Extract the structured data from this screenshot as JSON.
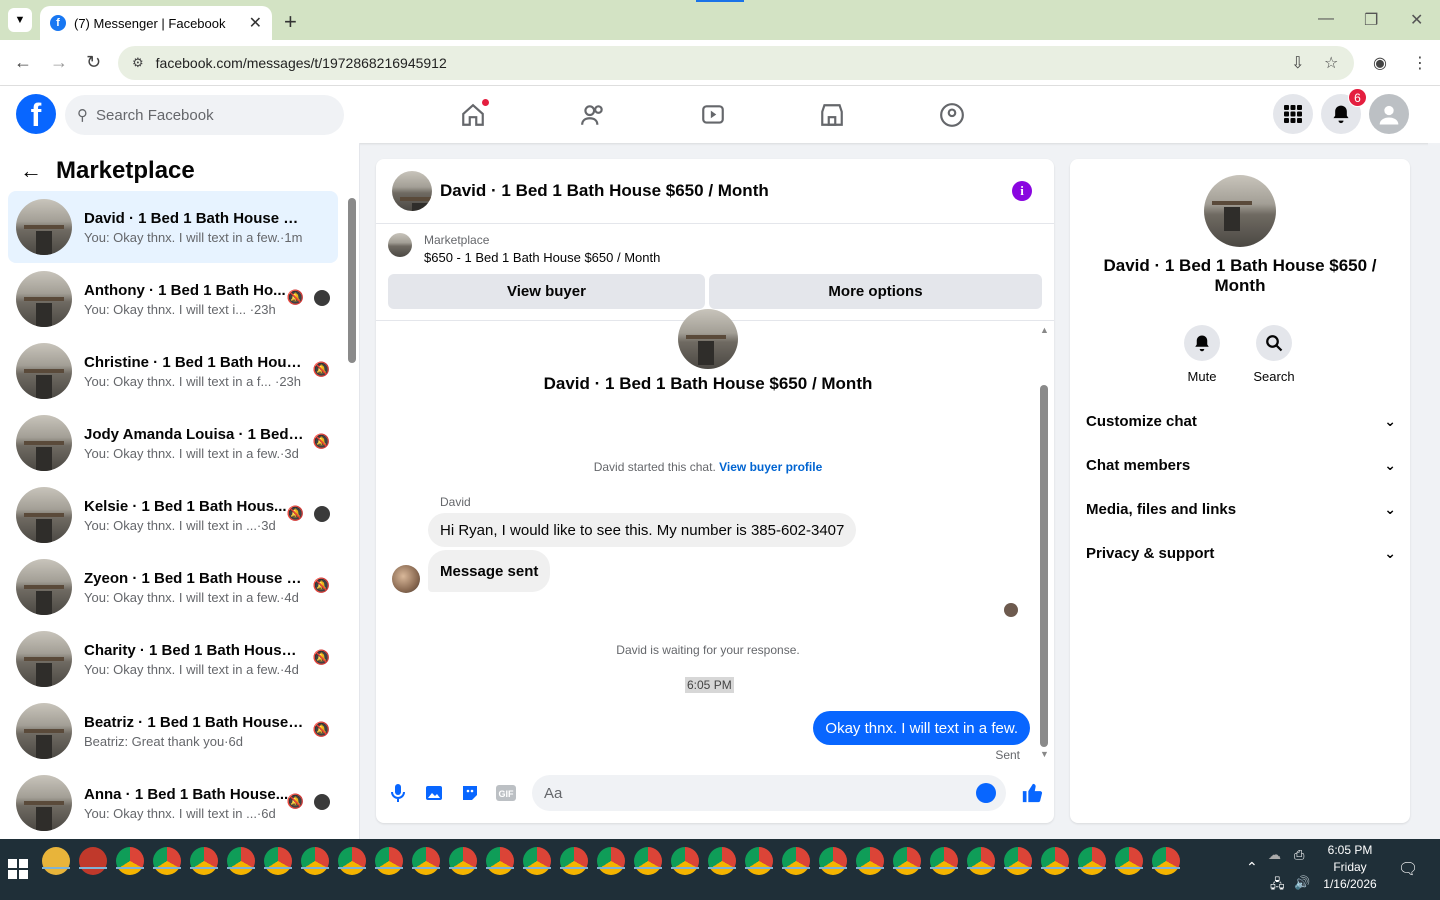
{
  "browser": {
    "tab_title": "(7) Messenger | Facebook",
    "url": "facebook.com/messages/t/1972868216945912"
  },
  "fb": {
    "search_placeholder": "Search Facebook",
    "notif_count": "6"
  },
  "sidebar": {
    "title": "Marketplace",
    "items": [
      {
        "title": "David · 1 Bed 1 Bath House $650...",
        "sub": "You: Okay thnx. I will text in a few.·1m",
        "active": true
      },
      {
        "title": "Anthony · 1 Bed 1 Bath Ho...",
        "sub": "You: Okay thnx. I will text i... ·23h"
      },
      {
        "title": "Christine · 1 Bed 1 Bath House...",
        "sub": "You: Okay thnx. I will text in a f... ·23h"
      },
      {
        "title": "Jody Amanda Louisa · 1 Bed 1 ...",
        "sub": "You: Okay thnx. I will text in a few.·3d"
      },
      {
        "title": "Kelsie · 1 Bed 1 Bath Hous...",
        "sub": "You: Okay thnx. I will text in ...·3d"
      },
      {
        "title": "Zyeon · 1 Bed 1 Bath House $6...",
        "sub": "You: Okay thnx. I will text in a few.·4d"
      },
      {
        "title": "Charity · 1 Bed 1 Bath House $...",
        "sub": "You: Okay thnx. I will text in a few.·4d"
      },
      {
        "title": "Beatriz · 1 Bed 1 Bath House $...",
        "sub": "Beatriz: Great thank you·6d"
      },
      {
        "title": "Anna · 1 Bed 1 Bath House...",
        "sub": "You: Okay thnx. I will text in ...·6d"
      }
    ]
  },
  "chat": {
    "title": "David · 1 Bed 1 Bath House $650 / Month",
    "marketplace_label": "Marketplace",
    "listing": "$650 - 1 Bed 1 Bath House $650 / Month",
    "view_buyer": "View buyer",
    "more_options": "More options",
    "started_text": "David started this chat.",
    "view_profile": "View buyer profile",
    "sender": "David",
    "msg1": "Hi Ryan, I would like to see this. My number is 385-602-3407",
    "msg2": "Message sent",
    "waiting": "David is waiting for your response.",
    "time": "6:05 PM",
    "my_msg": "Okay thnx. I will text in a few.",
    "sent_label": "Sent",
    "composer_placeholder": "Aa"
  },
  "details": {
    "name": "David · 1 Bed 1 Bath House $650 / Month",
    "mute": "Mute",
    "search": "Search",
    "sections": [
      "Customize chat",
      "Chat members",
      "Media, files and links",
      "Privacy & support"
    ]
  },
  "taskbar": {
    "time": "6:05 PM",
    "day": "Friday",
    "date": "1/16/2026"
  },
  "colors": {
    "accent": "#0866ff",
    "info": "#8a06e0",
    "badge": "#e41e3f"
  }
}
